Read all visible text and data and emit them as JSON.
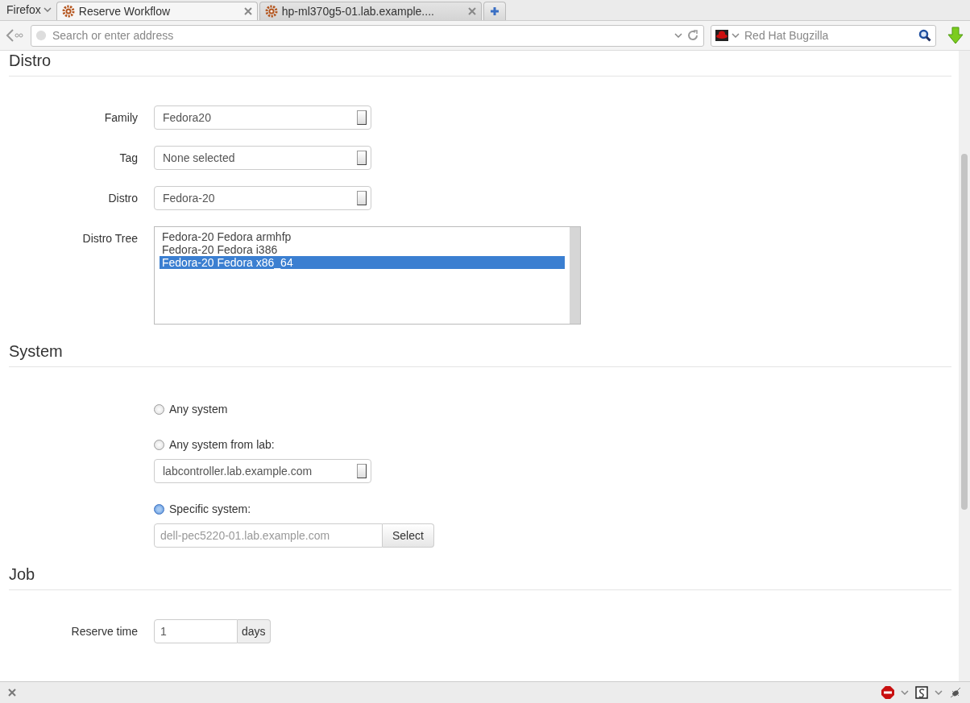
{
  "browser": {
    "menu_label": "Firefox",
    "tabs": [
      {
        "title": "Reserve Workflow",
        "selected": true
      },
      {
        "title": "hp-ml370g5-01.lab.example....",
        "selected": false
      }
    ],
    "address": {
      "placeholder": "Search or enter address"
    },
    "search": {
      "placeholder": "Red Hat Bugzilla"
    }
  },
  "distro": {
    "heading": "Distro",
    "fields": [
      {
        "label": "Family",
        "value": "Fedora20"
      },
      {
        "label": "Tag",
        "value": "None selected"
      },
      {
        "label": "Distro",
        "value": "Fedora-20"
      }
    ],
    "tree": {
      "label": "Distro Tree",
      "options": [
        {
          "text": "Fedora-20 Fedora armhfp",
          "selected": false
        },
        {
          "text": "Fedora-20 Fedora i386",
          "selected": false
        },
        {
          "text": "Fedora-20 Fedora x86_64",
          "selected": true
        }
      ]
    }
  },
  "system": {
    "heading": "System",
    "options": [
      {
        "kind": "plain",
        "label": "Any system",
        "selected": false
      },
      {
        "kind": "select",
        "label": "Any system from lab:",
        "selected": false,
        "value": "labcontroller.lab.example.com"
      },
      {
        "kind": "input",
        "label": "Specific system:",
        "selected": true,
        "placeholder": "dell-pec5220-01.lab.example.com",
        "button": "Select"
      }
    ]
  },
  "job": {
    "heading": "Job",
    "reserve_time": {
      "label": "Reserve time",
      "value": "1",
      "unit": "days"
    }
  }
}
